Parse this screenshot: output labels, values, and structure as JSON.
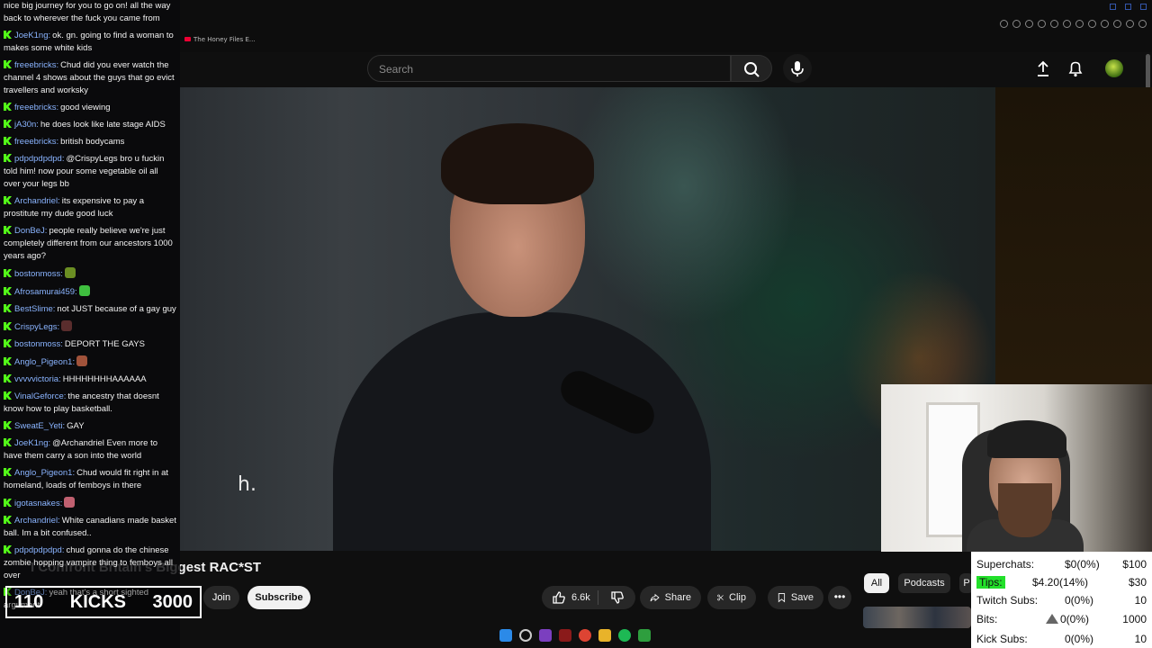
{
  "browser": {
    "tab_title": "The Honey Files E..."
  },
  "youtube": {
    "search_placeholder": "Search",
    "video_title": "I Confront Britain's Biggest RAC*ST",
    "subtitle_fragment": "h.",
    "join_label": "Join",
    "subscribe_label": "Subscribe",
    "like_count": "6.6k",
    "share_label": "Share",
    "clip_label": "Clip",
    "save_label": "Save",
    "chips": [
      "All",
      "Podcasts",
      "P"
    ]
  },
  "chat": {
    "messages": [
      {
        "user": "",
        "text": "nice big journey for you to go on! all the way back to wherever the fuck you came from"
      },
      {
        "user": "JoeK1ng:",
        "text": "ok. gn. going to find a woman to makes some white kids"
      },
      {
        "user": "freeebricks:",
        "text": "Chud did you ever watch the channel 4 shows about the guys that go evict travellers and worksky"
      },
      {
        "user": "freeebricks:",
        "text": "good viewing"
      },
      {
        "user": "jA30n:",
        "text": "he does look like late stage AIDS"
      },
      {
        "user": "freeebricks:",
        "text": "british bodycams"
      },
      {
        "user": "pdpdpdpdpd:",
        "text": "@CrispyLegs bro u fuckin told him! now pour some vegetable oil all over your legs bb"
      },
      {
        "user": "Archandriel:",
        "text": "its expensive to pay a prostitute my dude good luck"
      },
      {
        "user": "DonBeJ:",
        "text": "people really believe we're just completely different from our ancestors 1000 years ago?"
      },
      {
        "user": "bostonmoss:",
        "text": "",
        "emote": "#6b8e23"
      },
      {
        "user": "Afrosamurai459:",
        "text": "",
        "emote": "#3fbf3f"
      },
      {
        "user": "BestSlime:",
        "text": "not JUST because of a gay guy"
      },
      {
        "user": "CrispyLegs:",
        "text": "",
        "emote": "#5a2d2d"
      },
      {
        "user": "bostonmoss:",
        "text": "DEPORT THE GAYS"
      },
      {
        "user": "Anglo_Pigeon1:",
        "text": "",
        "emote": "#a0523a"
      },
      {
        "user": "vvvvvictoria:",
        "text": "HHHHHHHHAAAAAA"
      },
      {
        "user": "VinalGeforce:",
        "text": "the ancestry that doesnt know how to play basketball."
      },
      {
        "user": "SweatE_Yeti:",
        "text": "GAY"
      },
      {
        "user": "JoeK1ng:",
        "text": "@Archandriel Even more to have them carry a son into the world"
      },
      {
        "user": "Anglo_Pigeon1:",
        "text": "Chud would fit right in at homeland, loads of femboys in there"
      },
      {
        "user": "igotasnakes:",
        "text": "",
        "emote": "#c06070"
      },
      {
        "user": "Archandriel:",
        "text": "White canadians made basket ball. Im a bit confused.."
      },
      {
        "user": "pdpdpdpdpd:",
        "text": "chud gonna do the chinese zombie hopping vampire thing to femboys all over"
      },
      {
        "user": "DonBeJ:",
        "text": "yeah that's a short sighted argument"
      }
    ]
  },
  "kicks_counter": {
    "current": "110",
    "label": "KICKS",
    "goal": "3000"
  },
  "stats": {
    "rows": [
      {
        "label": "Superchats:",
        "value": "$0(0%)",
        "goal": "$100"
      },
      {
        "label": "Tips:",
        "value": "$4.20(14%)",
        "goal": "$30"
      },
      {
        "label": "Twitch Subs:",
        "value": "0(0%)",
        "goal": "10"
      },
      {
        "label": "Bits:",
        "value": "0(0%)",
        "goal": "1000"
      },
      {
        "label": "Kick Subs:",
        "value": "0(0%)",
        "goal": "10"
      }
    ]
  },
  "colors": {
    "kick_green": "#53fc18",
    "tips_highlight": "#22e02a",
    "chat_username": "#8ab4ff",
    "yt_background": "#0f0f0f"
  }
}
